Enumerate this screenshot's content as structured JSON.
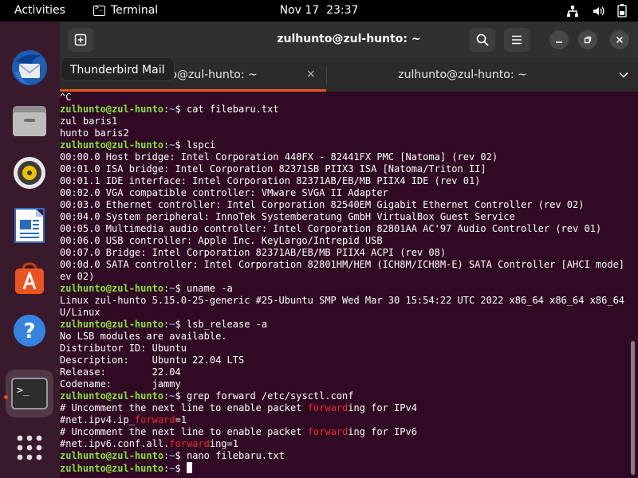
{
  "topbar": {
    "activities": "Activities",
    "app_name": "Terminal",
    "date": "Nov 17",
    "time": "23:37",
    "tray_icons": [
      "network-icon",
      "volume-icon",
      "battery-icon"
    ]
  },
  "dock": {
    "items": [
      "thunderbird-icon",
      "files-icon",
      "rhythmbox-icon",
      "libreoffice-writer-icon",
      "software-center-icon",
      "help-icon",
      "terminal-icon",
      "show-apps-icon"
    ],
    "tooltip": "Thunderbird Mail"
  },
  "window": {
    "title": "zulhunto@zul-hunto: ~",
    "tabs": [
      {
        "label": "zulhunto@zul-hunto: ~",
        "close": "×"
      },
      {
        "label": "zulhunto@zul-hunto: ~"
      }
    ]
  },
  "terminal": {
    "user": "zulhunto@zul-hunto",
    "lines": [
      {
        "text": "^C"
      },
      {
        "path": "~",
        "cmd": "cat filebaru.txt"
      },
      {
        "text": "zul baris1"
      },
      {
        "text": "hunto baris2"
      },
      {
        "path": "~",
        "cmd": "lspci"
      },
      {
        "text": "00:00.0 Host bridge: Intel Corporation 440FX - 82441FX PMC [Natoma] (rev 02)"
      },
      {
        "text": "00:01.0 ISA bridge: Intel Corporation 82371SB PIIX3 ISA [Natoma/Triton II]"
      },
      {
        "text": "00:01.1 IDE interface: Intel Corporation 82371AB/EB/MB PIIX4 IDE (rev 01)"
      },
      {
        "text": "00:02.0 VGA compatible controller: VMware SVGA II Adapter"
      },
      {
        "text": "00:03.0 Ethernet controller: Intel Corporation 82540EM Gigabit Ethernet Controller (rev 02)"
      },
      {
        "text": "00:04.0 System peripheral: InnoTek Systemberatung GmbH VirtualBox Guest Service"
      },
      {
        "text": "00:05.0 Multimedia audio controller: Intel Corporation 82801AA AC'97 Audio Controller (rev 01)"
      },
      {
        "text": "00:06.0 USB controller: Apple Inc. KeyLargo/Intrepid USB"
      },
      {
        "text": "00:07.0 Bridge: Intel Corporation 82371AB/EB/MB PIIX4 ACPI (rev 08)"
      },
      {
        "text": "00:0d.0 SATA controller: Intel Corporation 82801HM/HEM (ICH8M/ICH8M-E) SATA Controller [AHCI mode] (r"
      },
      {
        "text": "ev 02)"
      },
      {
        "path": "~",
        "cmd": "uname -a"
      },
      {
        "text": "Linux zul-hunto 5.15.0-25-generic #25-Ubuntu SMP Wed Mar 30 15:54:22 UTC 2022 x86_64 x86_64 x86_64 GN"
      },
      {
        "text": "U/Linux"
      },
      {
        "path": "~",
        "cmd": "lsb_release -a"
      },
      {
        "text": "No LSB modules are available."
      },
      {
        "text": "Distributor ID:\tUbuntu"
      },
      {
        "text": "Description:\tUbuntu 22.04 LTS"
      },
      {
        "text": "Release:\t22.04"
      },
      {
        "text": "Codename:\tjammy"
      },
      {
        "path": "~",
        "cmd": "grep forward /etc/sysctl.conf"
      },
      {
        "pre": "# Uncomment the next line to enable packet ",
        "hl": "forward",
        "post": "ing for IPv4"
      },
      {
        "pre": "#net.ipv4.ip_",
        "hl": "forward",
        "post": "=1"
      },
      {
        "pre": "# Uncomment the next line to enable packet ",
        "hl": "forward",
        "post": "ing for IPv6"
      },
      {
        "pre": "#net.ipv6.conf.all.",
        "hl": "forward",
        "post": "ing=1"
      },
      {
        "path": "~",
        "cmd": "nano filebaru.txt"
      },
      {
        "path": "~",
        "cmd": "",
        "cursor": true
      }
    ]
  }
}
